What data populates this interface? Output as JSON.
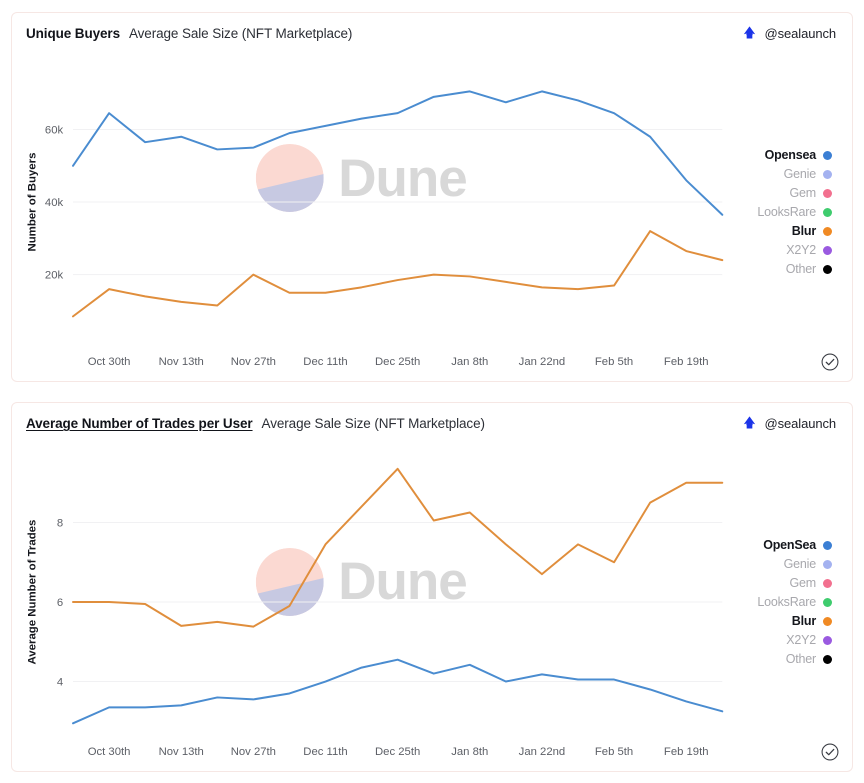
{
  "page": {
    "background": "#ffffff",
    "card_border": "#f6e7e4"
  },
  "brand": {
    "handle": "@sealaunch",
    "logo_icon": "sealaunch-logo-icon",
    "logo_color": "#1b34e8"
  },
  "watermark": {
    "text": "Dune",
    "mark_icon": "dune-logo-icon",
    "top_color": "#fbd9d2",
    "bottom_color": "#c7c9e2",
    "text_color": "#d8d8d8"
  },
  "verified_icon": "verified-check-icon",
  "palette": {
    "opensea": "#3b7fd4",
    "genie": "#a4b2f0",
    "gem": "#f2708f",
    "looksrare": "#3fcc6e",
    "blur": "#f08a24",
    "x2y2": "#9a5ae0",
    "other": "#000000",
    "grid": "#f1f1f3",
    "blur_line": "#e08e3c",
    "opensea_line": "#4a8cd0"
  },
  "cards": [
    {
      "id": "unique-buyers-card",
      "title_main": "Unique Buyers",
      "title_main_underlined": false,
      "title_sub": "Average Sale Size (NFT Marketplace)",
      "legend": [
        {
          "label": "Opensea",
          "color": "#3b7fd4",
          "active": true
        },
        {
          "label": "Genie",
          "color": "#a4b2f0",
          "active": false
        },
        {
          "label": "Gem",
          "color": "#f2708f",
          "active": false
        },
        {
          "label": "LooksRare",
          "color": "#3fcc6e",
          "active": false
        },
        {
          "label": "Blur",
          "color": "#f08a24",
          "active": true
        },
        {
          "label": "X2Y2",
          "color": "#9a5ae0",
          "active": false
        },
        {
          "label": "Other",
          "color": "#000000",
          "active": false
        }
      ],
      "chart_data": {
        "type": "line",
        "title": "Unique Buyers — Average Sale Size (NFT Marketplace)",
        "xlabel": "",
        "ylabel": "Number of Buyers",
        "grid": true,
        "legend_position": "right",
        "ylim": [
          0,
          80000
        ],
        "yticks": [
          20000,
          40000,
          60000
        ],
        "ytick_labels": [
          "20k",
          "40k",
          "60k"
        ],
        "x": [
          "Oct 23rd",
          "Oct 30th",
          "Nov 6th",
          "Nov 13th",
          "Nov 20th",
          "Nov 27th",
          "Dec 4th",
          "Dec 11th",
          "Dec 18th",
          "Dec 25th",
          "Jan 1st",
          "Jan 8th",
          "Jan 15th",
          "Jan 22nd",
          "Jan 29th",
          "Feb 5th",
          "Feb 12th",
          "Feb 19th",
          "Feb 26th"
        ],
        "xtick_labels": [
          "Oct 30th",
          "Nov 13th",
          "Nov 27th",
          "Dec 11th",
          "Dec 25th",
          "Jan 8th",
          "Jan 22nd",
          "Feb 5th",
          "Feb 19th"
        ],
        "series": [
          {
            "name": "Opensea",
            "color": "#4a8cd0",
            "values": [
              50000,
              64500,
              56500,
              58000,
              54500,
              55000,
              59000,
              61000,
              63000,
              64500,
              69000,
              70500,
              67500,
              70500,
              68000,
              64500,
              58000,
              46000,
              36500
            ]
          },
          {
            "name": "Blur",
            "color": "#e08e3c",
            "values": [
              8500,
              16000,
              14000,
              12500,
              11500,
              20000,
              15000,
              15000,
              16500,
              18500,
              20000,
              19500,
              18000,
              16500,
              16000,
              17000,
              32000,
              26500,
              24000
            ]
          }
        ]
      }
    },
    {
      "id": "average-trades-card",
      "title_main": "Average Number of Trades per User",
      "title_main_underlined": true,
      "title_sub": "Average Sale Size (NFT Marketplace)",
      "legend": [
        {
          "label": "OpenSea",
          "color": "#3b7fd4",
          "active": true
        },
        {
          "label": "Genie",
          "color": "#a4b2f0",
          "active": false
        },
        {
          "label": "Gem",
          "color": "#f2708f",
          "active": false
        },
        {
          "label": "LooksRare",
          "color": "#3fcc6e",
          "active": false
        },
        {
          "label": "Blur",
          "color": "#f08a24",
          "active": true
        },
        {
          "label": "X2Y2",
          "color": "#9a5ae0",
          "active": false
        },
        {
          "label": "Other",
          "color": "#000000",
          "active": false
        }
      ],
      "chart_data": {
        "type": "line",
        "title": "Average Number of Trades per User — Average Sale Size (NFT Marketplace)",
        "xlabel": "",
        "ylabel": "Average Number of Trades",
        "grid": true,
        "legend_position": "right",
        "ylim": [
          2.6,
          9.9
        ],
        "yticks": [
          4,
          6,
          8
        ],
        "ytick_labels": [
          "4",
          "6",
          "8"
        ],
        "x": [
          "Oct 23rd",
          "Oct 30th",
          "Nov 6th",
          "Nov 13th",
          "Nov 20th",
          "Nov 27th",
          "Dec 4th",
          "Dec 11th",
          "Dec 18th",
          "Dec 25th",
          "Jan 1st",
          "Jan 8th",
          "Jan 15th",
          "Jan 22nd",
          "Jan 29th",
          "Feb 5th",
          "Feb 12th",
          "Feb 19th",
          "Feb 26th"
        ],
        "xtick_labels": [
          "Oct 30th",
          "Nov 13th",
          "Nov 27th",
          "Dec 11th",
          "Dec 25th",
          "Jan 8th",
          "Jan 22nd",
          "Feb 5th",
          "Feb 19th"
        ],
        "series": [
          {
            "name": "Blur",
            "color": "#e08e3c",
            "values": [
              6.0,
              6.0,
              5.95,
              5.4,
              5.5,
              5.38,
              5.9,
              7.45,
              8.4,
              9.35,
              8.05,
              8.25,
              7.45,
              6.7,
              7.45,
              7.0,
              8.5,
              9.0,
              9.0
            ]
          },
          {
            "name": "OpenSea",
            "color": "#4a8cd0",
            "values": [
              2.95,
              3.35,
              3.35,
              3.4,
              3.6,
              3.55,
              3.7,
              4.0,
              4.35,
              4.55,
              4.2,
              4.42,
              4.0,
              4.18,
              4.05,
              4.05,
              3.8,
              3.5,
              3.25
            ]
          }
        ]
      }
    }
  ]
}
